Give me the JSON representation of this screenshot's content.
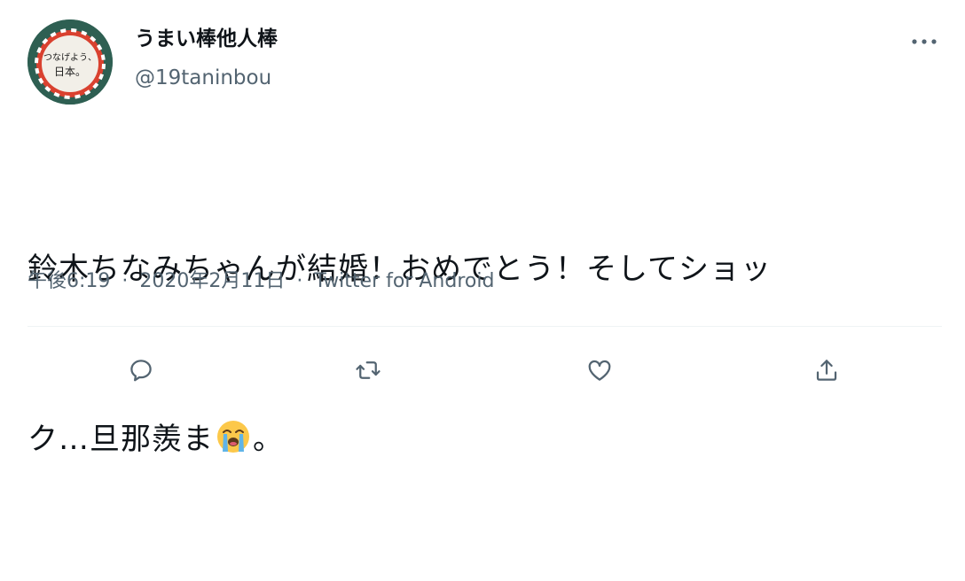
{
  "user": {
    "display_name": "うまい棒他人棒",
    "handle": "@19taninbou",
    "avatar_text_line1": "つなげよう、",
    "avatar_text_line2": "日本。"
  },
  "tweet": {
    "text_line1": "鈴木ちなみちゃんが結婚！おめでとう！そしてショッ",
    "text_line2_before_emoji": "ク…旦那羨ま",
    "text_line2_after_emoji": "。",
    "emoji": "loudly-crying-face"
  },
  "meta": {
    "time": "午後6:19",
    "separator": "·",
    "date": "2020年2月11日",
    "source": "Twitter for Android"
  },
  "actions": {
    "icons": [
      "reply-icon",
      "retweet-icon",
      "like-icon",
      "share-icon"
    ]
  },
  "colors": {
    "text": "#0f1419",
    "secondary": "#536471",
    "divider": "#eff3f4",
    "avatar_bg": "#2e5f52",
    "avatar_ring": "#d9412f"
  }
}
